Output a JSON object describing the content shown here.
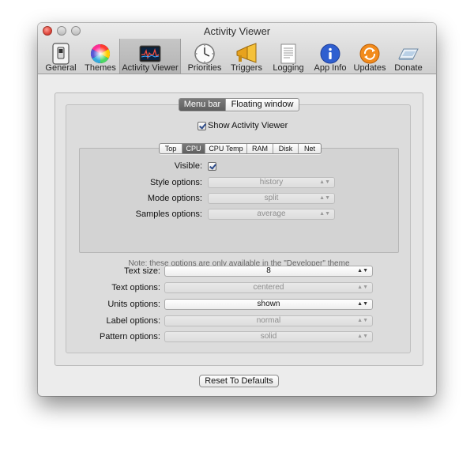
{
  "window": {
    "title": "Activity Viewer"
  },
  "toolbar": {
    "items": [
      {
        "label": "General",
        "icon": "switch-icon"
      },
      {
        "label": "Themes",
        "icon": "color-wheel-icon"
      },
      {
        "label": "Activity Viewer",
        "icon": "activity-monitor-icon",
        "selected": true
      },
      {
        "label": "Priorities",
        "icon": "clock-icon"
      },
      {
        "label": "Triggers",
        "icon": "megaphone-icon"
      },
      {
        "label": "Logging",
        "icon": "log-document-icon"
      },
      {
        "label": "App Info",
        "icon": "info-icon"
      },
      {
        "label": "Updates",
        "icon": "updates-icon"
      },
      {
        "label": "Donate",
        "icon": "donate-icon"
      }
    ]
  },
  "main_tabs": [
    "Menu bar",
    "Floating window"
  ],
  "main_tab_selected": "Menu bar",
  "show_activity_viewer": {
    "label": "Show Activity Viewer",
    "checked": true
  },
  "sub_tabs": [
    "Top",
    "CPU",
    "CPU Temp",
    "RAM",
    "Disk",
    "Net"
  ],
  "sub_tab_selected": "CPU",
  "cpu_panel": {
    "visible_label": "Visible:",
    "visible_checked": true,
    "style_label": "Style options:",
    "style_value": "history",
    "mode_label": "Mode options:",
    "mode_value": "split",
    "samples_label": "Samples options:",
    "samples_value": "average",
    "note": "Note: these options are only available in the \"Developer\" theme"
  },
  "text_size": {
    "label": "Text size:",
    "value": "8"
  },
  "text_options": {
    "label": "Text options:",
    "value": "centered"
  },
  "units_options": {
    "label": "Units options:",
    "value": "shown"
  },
  "label_options": {
    "label": "Label options:",
    "value": "normal"
  },
  "pattern_options": {
    "label": "Pattern options:",
    "value": "solid"
  },
  "reset_button": "Reset To Defaults",
  "colors": {
    "selected_segment": "#666666",
    "window_bg": "#ececec",
    "close_button": "#e0483d"
  }
}
